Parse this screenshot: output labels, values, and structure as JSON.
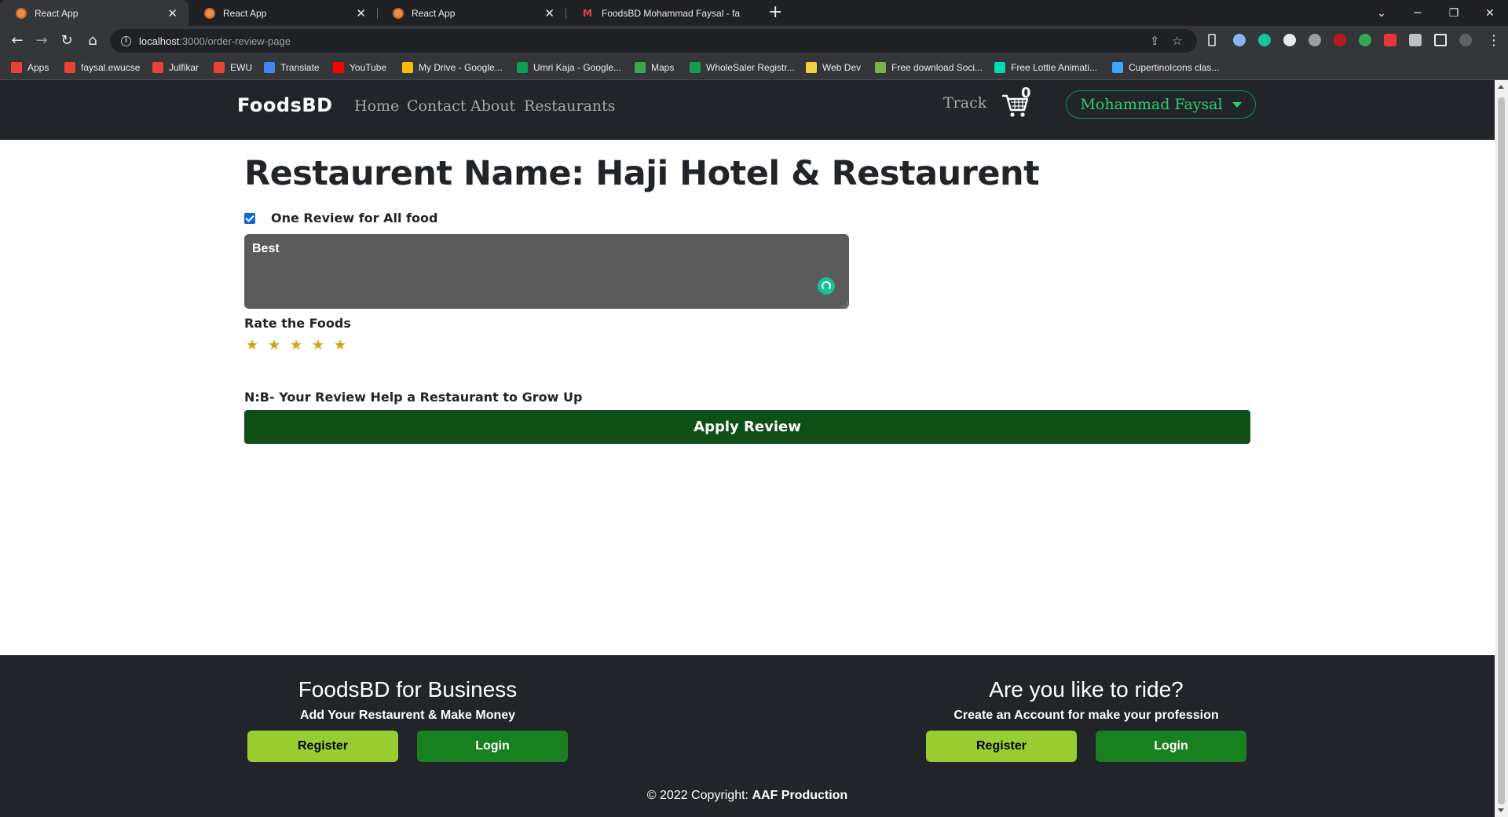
{
  "browser": {
    "tabs": [
      {
        "title": "React App",
        "icon": "react-app-favicon"
      },
      {
        "title": "React App",
        "icon": "react-app-favicon"
      },
      {
        "title": "React App",
        "icon": "react-app-favicon"
      },
      {
        "title": "FoodsBD Mohammad Faysal - fa",
        "icon": "gmail-icon"
      }
    ],
    "new_tab": "+",
    "url_host": "localhost",
    "url_path": ":3000/order-review-page",
    "bookmarks": [
      {
        "label": "Apps",
        "icon": "apps-grid-icon",
        "color": "#ea4335"
      },
      {
        "label": "faysal.ewucse",
        "icon": "gmail-icon",
        "color": "#ea4335"
      },
      {
        "label": "Julfikar",
        "icon": "gmail-icon",
        "color": "#ea4335"
      },
      {
        "label": "EWU",
        "icon": "gmail-icon",
        "color": "#ea4335"
      },
      {
        "label": "Translate",
        "icon": "translate-icon",
        "color": "#4285f4"
      },
      {
        "label": "YouTube",
        "icon": "youtube-icon",
        "color": "#ff0000"
      },
      {
        "label": "My Drive - Google...",
        "icon": "drive-icon",
        "color": "#fbbc04"
      },
      {
        "label": "Umri Kaja - Google...",
        "icon": "sheets-icon",
        "color": "#0f9d58"
      },
      {
        "label": "Maps",
        "icon": "maps-icon",
        "color": "#34a853"
      },
      {
        "label": "WholeSaler Registr...",
        "icon": "sheets-icon",
        "color": "#0f9d58"
      },
      {
        "label": "Web Dev",
        "icon": "folder-icon",
        "color": "#f4d03f"
      },
      {
        "label": "Free download Soci...",
        "icon": "leaf-icon",
        "color": "#7cb342"
      },
      {
        "label": "Free Lottie Animati...",
        "icon": "lottie-icon",
        "color": "#00ddb3"
      },
      {
        "label": "CupertinoIcons clas...",
        "icon": "flutter-icon",
        "color": "#42a5f5"
      }
    ]
  },
  "site": {
    "brand": "FoodsBD",
    "nav": [
      "Home",
      "Contact",
      "About",
      "Restaurants"
    ],
    "track": "Track",
    "cart_count": "0",
    "user_name": "Mohammad Faysal"
  },
  "review": {
    "heading": "Restaurent Name: Haji Hotel & Restaurent",
    "one_review_label": "One Review for All food",
    "one_review_checked": true,
    "review_text": "Best",
    "rate_label": "Rate the Foods",
    "rating": 5,
    "stars": [
      "★",
      "★",
      "★",
      "★",
      "★"
    ],
    "note": "N:B- Your Review Help a Restaurant to Grow Up",
    "apply_label": "Apply Review"
  },
  "footer": {
    "business": {
      "title": "FoodsBD for Business",
      "subtitle": "Add Your Restaurent & Make Money",
      "register": "Register",
      "login": "Login"
    },
    "rider": {
      "title": "Are you like to ride?",
      "subtitle": "Create an Account for make your profession",
      "register": "Register",
      "login": "Login"
    },
    "copyright_prefix": "© 2022 Copyright:",
    "copyright_owner": "AAF Production"
  },
  "colors": {
    "nav_bg": "#212529",
    "accent_green": "#2ecc71",
    "apply_bg": "#0f5019",
    "register_bg": "#9acd32",
    "login_bg": "#198020",
    "star": "#d4a017"
  }
}
